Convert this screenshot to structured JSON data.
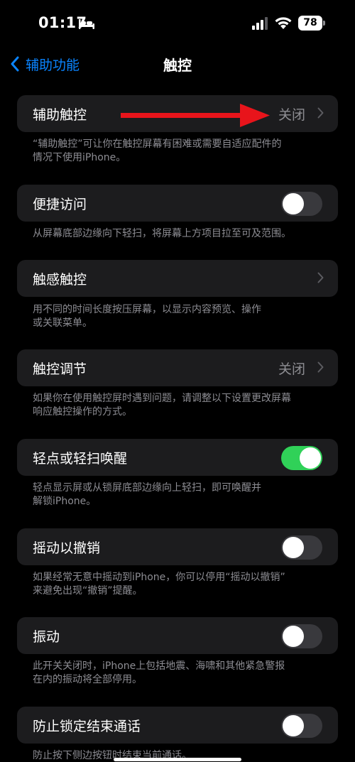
{
  "status_bar": {
    "time": "01:17",
    "battery": "78"
  },
  "nav": {
    "back_label": "辅助功能",
    "title": "触控"
  },
  "rows": [
    {
      "label": "辅助触控",
      "value": "关闭",
      "footnote_line1": "“辅助触控”可让你在触控屏幕有困难或需要自适应配件的",
      "footnote_line2": "情况下使用iPhone。"
    },
    {
      "label": "便捷访问",
      "toggle": "off",
      "footnote_line1": "从屏幕底部边缘向下轻扫，将屏幕上方项目拉至可及范围。",
      "footnote_line2": ""
    },
    {
      "label": "触感触控",
      "value": "",
      "footnote_line1": "用不同的时间长度按压屏幕，以显示内容预览、操作",
      "footnote_line2": "或关联菜单。"
    },
    {
      "label": "触控调节",
      "value": "关闭",
      "footnote_line1": "如果你在使用触控屏时遇到问题，请调整以下设置更改屏幕",
      "footnote_line2": "响应触控操作的方式。"
    },
    {
      "label": "轻点或轻扫唤醒",
      "toggle": "on",
      "footnote_line1": "轻点显示屏或从锁屏底部边缘向上轻扫，即可唤醒并",
      "footnote_line2": "解锁iPhone。"
    },
    {
      "label": "摇动以撤销",
      "toggle": "off",
      "footnote_line1": "如果经常无意中摇动到iPhone，你可以停用“摇动以撤销”",
      "footnote_line2": "来避免出现“撤销”提醒。"
    },
    {
      "label": "振动",
      "toggle": "off",
      "footnote_line1": "此开关关闭时，iPhone上包括地震、海啸和其他紧急警报",
      "footnote_line2": "在内的振动将全部停用。"
    },
    {
      "label": "防止锁定结束通话",
      "toggle": "off",
      "footnote_line1": "防止按下侧边按钮时结束当前通话。",
      "footnote_line2": ""
    }
  ],
  "colors": {
    "accent": "#0a84ff",
    "toggle_on": "#30d158",
    "toggle_off": "#39393d",
    "arrow": "#e8141b",
    "cell": "#1c1c1e"
  }
}
